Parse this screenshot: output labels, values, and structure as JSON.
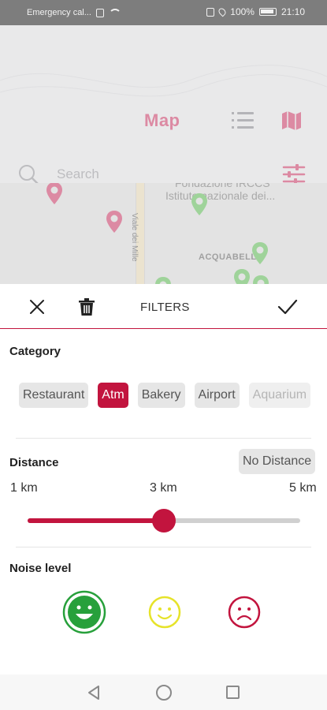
{
  "status_bar": {
    "carrier": "Emergency cal...",
    "battery": "100%",
    "time": "21:10"
  },
  "header": {
    "title": "Map",
    "search_placeholder": "Search"
  },
  "map": {
    "place_1": "Fondazione IRCCS",
    "place_2": "Istituto nazionale dei...",
    "road_label": "Viale dei Mille",
    "area_label": "ACQUABELLA"
  },
  "filters": {
    "title": "FILTERS",
    "category": {
      "title": "Category",
      "chips": [
        "Restaurant",
        "Atm",
        "Bakery",
        "Airport",
        "Aquarium"
      ],
      "selected": "Atm"
    },
    "distance": {
      "title": "Distance",
      "no_distance_label": "No Distance",
      "min_label": "1 km",
      "mid_label": "3 km",
      "max_label": "5 km",
      "value_fraction": 0.5
    },
    "noise": {
      "title": "Noise level",
      "levels": [
        "happy-face-icon",
        "neutral-face-icon",
        "sad-face-icon"
      ],
      "colors": [
        "#27a03b",
        "#e6e32a",
        "#c2143e"
      ]
    }
  },
  "colors": {
    "accent": "#c2143e",
    "header_accent": "#dc8aa3"
  }
}
